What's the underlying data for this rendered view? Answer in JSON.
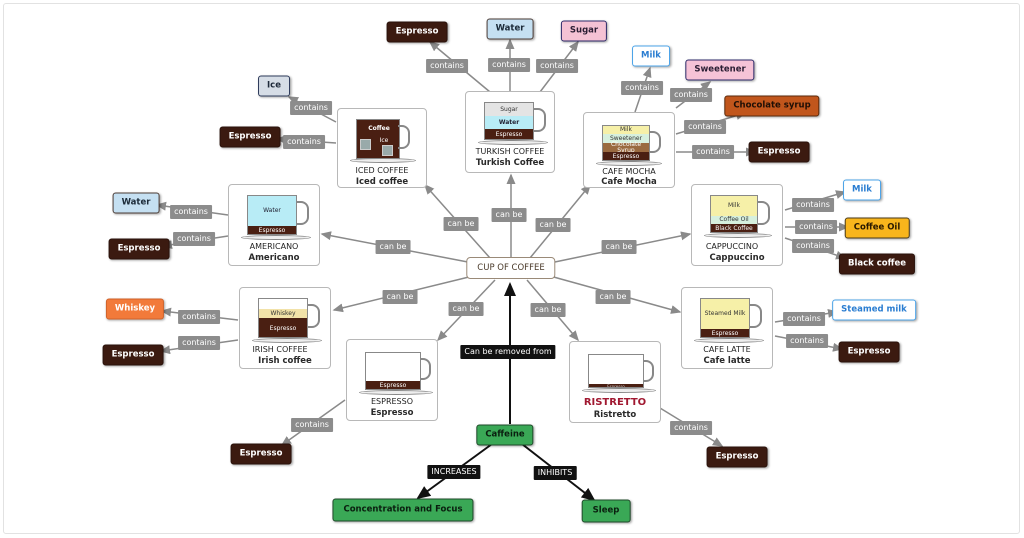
{
  "title": "CUP OF COFFEE",
  "relation_labels": {
    "can_be": "can be",
    "contains": "contains",
    "can_be_removed_from": "Can be removed from",
    "increases": "INCREASES",
    "inhibits": "INHIBITS"
  },
  "drinks": {
    "iced": {
      "name": "ICED COFFEE",
      "subtitle": "Iced coffee",
      "layers": [
        "Coffee",
        "Ice"
      ]
    },
    "turkish": {
      "name": "TURKISH COFFEE",
      "subtitle": "Turkish Coffee",
      "layers": [
        "Sugar",
        "Water",
        "Espresso"
      ]
    },
    "mocha": {
      "name": "CAFE MOCHA",
      "subtitle": "Cafe Mocha",
      "layers": [
        "Milk",
        "Sweetener",
        "Chocolate Syrup",
        "Espresso"
      ]
    },
    "americano": {
      "name": "AMERICANO",
      "subtitle": "Americano",
      "layers": [
        "Water",
        "Espresso"
      ]
    },
    "cappuccino": {
      "name": "CAPPUCCINO",
      "subtitle": "Cappuccino",
      "layers": [
        "Milk",
        "Coffee Oil",
        "Black Coffee"
      ]
    },
    "irish": {
      "name": "IRISH COFFEE",
      "subtitle": "Irish coffee",
      "layers": [
        "Whiskey",
        "Espresso"
      ]
    },
    "latte": {
      "name": "CAFE LATTE",
      "subtitle": "Cafe latte",
      "layers": [
        "Steamed Milk",
        "Espresso"
      ]
    },
    "espresso": {
      "name": "ESPRESSO",
      "subtitle": "Espresso",
      "layers": [
        "Espresso"
      ]
    },
    "ristretto": {
      "name": "RISTRETTO",
      "subtitle": "Ristretto",
      "layers": [
        "Espresso"
      ]
    }
  },
  "ingredients": {
    "iced": [
      "Ice",
      "Espresso"
    ],
    "turkish": [
      "Espresso",
      "Water",
      "Sugar"
    ],
    "mocha": [
      "Milk",
      "Sweetener",
      "Chocolate syrup",
      "Espresso"
    ],
    "americano": [
      "Water",
      "Espresso"
    ],
    "cappuccino": [
      "Milk",
      "Coffee Oil",
      "Black coffee"
    ],
    "irish": [
      "Whiskey",
      "Espresso"
    ],
    "latte": [
      "Steamed milk",
      "Espresso"
    ],
    "espresso": [
      "Espresso"
    ],
    "ristretto": [
      "Espresso"
    ]
  },
  "caffeine": {
    "label": "Caffeine",
    "effects": [
      "Concentration and Focus",
      "Sleep"
    ]
  },
  "colors": {
    "espresso": "#3b1a10",
    "water": "#c5e0f2",
    "milk_accent": "#2a7dd1",
    "chocolate": "#c1561c",
    "whiskey": "#f27a3a",
    "coffee_oil": "#f8b51c",
    "green": "#3aa856",
    "ristretto_title": "#a01830"
  }
}
